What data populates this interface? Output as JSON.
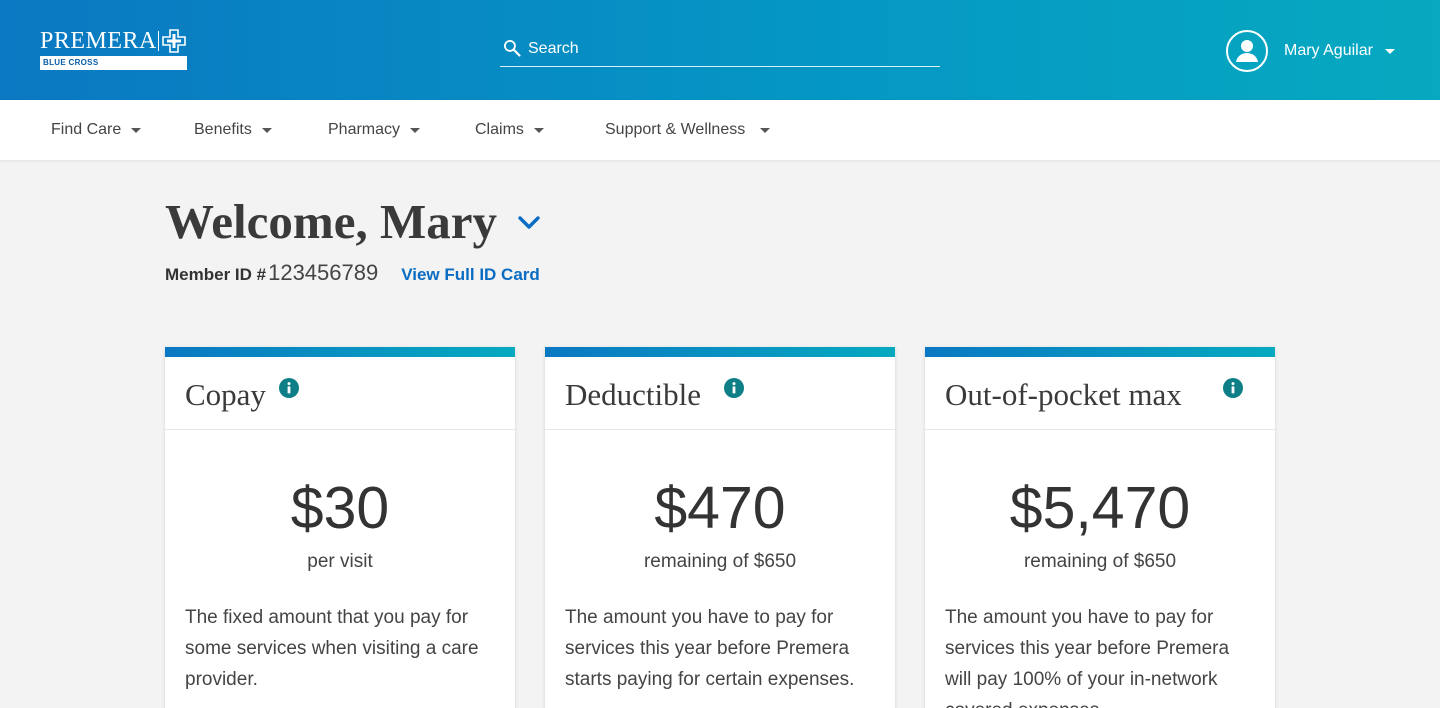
{
  "brand": {
    "name": "PREMERA",
    "tagline": "BLUE CROSS",
    "color_primary": "#0a78c2",
    "color_secondary": "#06a9c0",
    "color_link": "#0a6cc2",
    "color_info": "#0e7f86"
  },
  "header": {
    "search": {
      "placeholder": "Search",
      "value": "",
      "icon": "search-icon"
    },
    "user": {
      "name": "Mary Aguilar",
      "icon": "account-circle-icon"
    }
  },
  "nav": {
    "items": [
      {
        "label": "Find Care"
      },
      {
        "label": "Benefits"
      },
      {
        "label": "Pharmacy"
      },
      {
        "label": "Claims"
      },
      {
        "label": "Support & Wellness"
      }
    ]
  },
  "welcome": {
    "title": "Welcome, Mary",
    "member_id_label": "Member ID #",
    "member_id": "123456789",
    "id_card_link": "View Full ID Card"
  },
  "cards": [
    {
      "title": "Copay",
      "amount": "$30",
      "subtitle": "per visit",
      "description": "The fixed amount that you pay for some services when visiting a care provider."
    },
    {
      "title": "Deductible",
      "amount": "$470",
      "subtitle": "remaining of $650",
      "description": "The amount you have to pay for services this year before Premera starts paying for certain expenses."
    },
    {
      "title": "Out-of-pocket max",
      "amount": "$5,470",
      "subtitle": "remaining of $650",
      "description": "The amount you have to pay for services this year before Premera will pay 100% of your in-network covered expenses."
    }
  ]
}
